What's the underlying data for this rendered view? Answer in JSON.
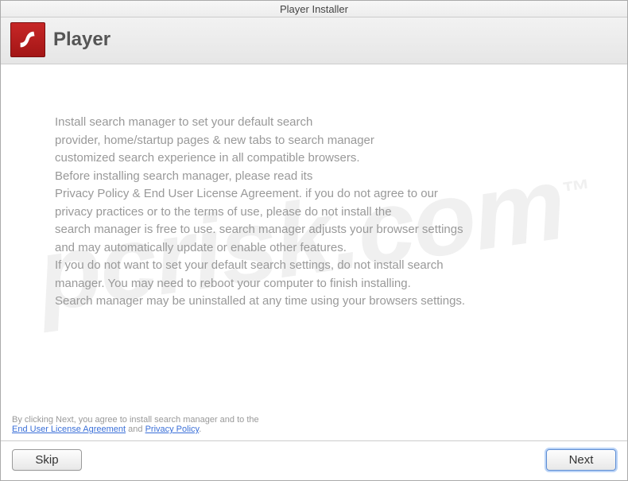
{
  "window": {
    "title": "Player Installer"
  },
  "header": {
    "title": "Player"
  },
  "body": {
    "text": "Install search manager to set your default search\nprovider, home/startup pages & new tabs to search manager\ncustomized search experience in all compatible browsers.\nBefore installing search manager, please read its\nPrivacy Policy & End User License Agreement. if you do not agree to our\nprivacy practices or to the terms of use, please do not install the\nsearch manager is free to use. search manager adjusts your browser settings\nand may automatically update or enable other features.\nIf you do not want to set your default search settings, do not install search\nmanager. You may need to reboot your computer to finish installing.\nSearch manager may be uninstalled at any time using your browsers settings."
  },
  "disclaimer": {
    "prefix": "By clicking Next, you agree to install search manager and to the",
    "eula": "End User License Agreement",
    "and": " and ",
    "privacy": "Privacy Policy",
    "suffix": "."
  },
  "footer": {
    "skip": "Skip",
    "next": "Next"
  },
  "watermark": {
    "text": "pcrisk.com"
  }
}
